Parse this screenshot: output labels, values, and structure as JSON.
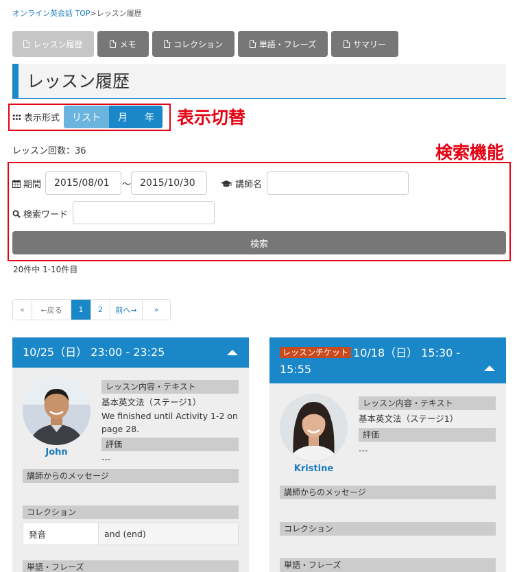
{
  "breadcrumb": {
    "home": "オンライン英会話 TOP",
    "separator": ">",
    "current": "レッスン履歴"
  },
  "tabs": [
    {
      "label": "レッスン履歴",
      "active": true
    },
    {
      "label": "メモ",
      "active": false
    },
    {
      "label": "コレクション",
      "active": false
    },
    {
      "label": "単語・フレーズ",
      "active": false
    },
    {
      "label": "サマリー",
      "active": false
    }
  ],
  "page_title": "レッスン履歴",
  "annotations": {
    "view_switch": "表示切替",
    "search": "検索機能"
  },
  "view_switch": {
    "label": "表示形式",
    "options": [
      "リスト",
      "月",
      "年"
    ],
    "selected": "リスト"
  },
  "lesson_count": "レッスン回数：36",
  "search": {
    "period_label": "期間",
    "date_from": "2015/08/01",
    "tilde": "～",
    "date_to": "2015/10/30",
    "teacher_label": "講師名",
    "teacher_value": "",
    "keyword_label": "検索ワード",
    "keyword_value": "",
    "button": "検索"
  },
  "result_range": "20件中 1-10件目",
  "pagination": [
    "«",
    "←戻る",
    "1",
    "2",
    "前へ→",
    "»"
  ],
  "colors": {
    "accent": "#1a87c9",
    "annotation": "#e60012",
    "ticket": "#c94a1c"
  },
  "cards": [
    {
      "ticket": "",
      "datetime": "10/25（日） 23:00 - 23:25",
      "teacher": "John",
      "content_label": "レッスン内容・テキスト",
      "content_title": "基本英文法（ステージ1）",
      "content_note": "We finished until Activity 1-2 on page 28.",
      "rating_label": "評価",
      "rating": "---",
      "message_label": "講師からのメッセージ",
      "collection_label": "コレクション",
      "collection": [
        {
          "term": "発音",
          "value": "and (end)"
        }
      ],
      "phrases_label": "単語・フレーズ"
    },
    {
      "ticket": "レッスンチケット",
      "datetime": "10/18（日） 15:30 - 15:55",
      "teacher": "Kristine",
      "content_label": "レッスン内容・テキスト",
      "content_title": "基本英文法（ステージ1）",
      "content_note": "",
      "rating_label": "評価",
      "rating": "---",
      "message_label": "講師からのメッセージ",
      "collection_label": "コレクション",
      "collection": [],
      "phrases_label": "単語・フレーズ"
    }
  ]
}
